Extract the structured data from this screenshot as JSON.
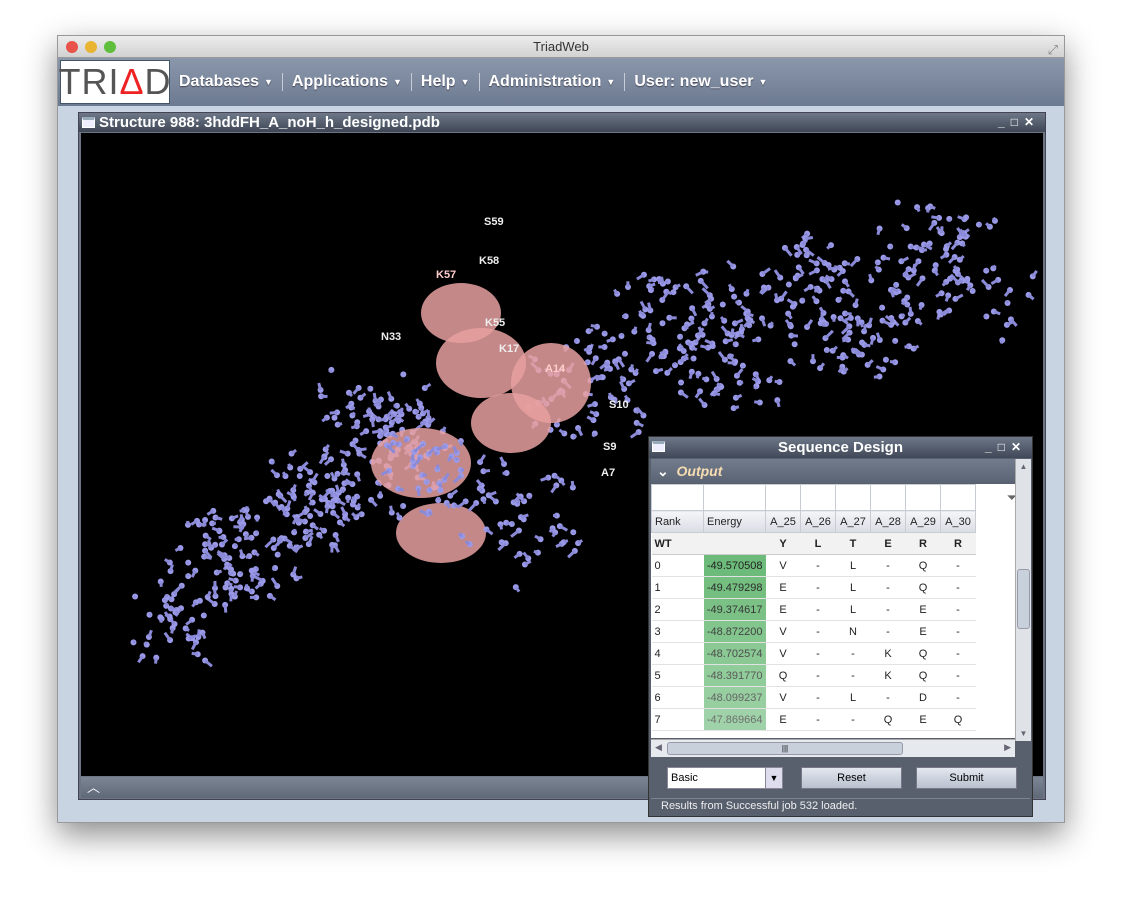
{
  "window": {
    "title": "TriadWeb"
  },
  "nav": {
    "logo": "TRIAD",
    "items": [
      {
        "label": "Databases"
      },
      {
        "label": "Applications"
      },
      {
        "label": "Help"
      },
      {
        "label": "Administration"
      },
      {
        "label": "User: new_user"
      }
    ]
  },
  "structure": {
    "title": "Structure 988: 3hddFH_A_noH_h_designed.pdb",
    "residue_labels": [
      "S59",
      "K58",
      "K57",
      "K55",
      "K17",
      "N33",
      "A14",
      "S10",
      "S9",
      "A7"
    ],
    "expand_icon": "chevron-up-icon"
  },
  "dialog": {
    "title": "Sequence Design",
    "section": "Output",
    "columns": [
      "Rank",
      "Energy",
      "A_25",
      "A_26",
      "A_27",
      "A_28",
      "A_29",
      "A_30"
    ],
    "wt": {
      "label": "WT",
      "residues": [
        "Y",
        "L",
        "T",
        "E",
        "R",
        "R"
      ]
    },
    "rows": [
      {
        "rank": "0",
        "energy": "-49.570508",
        "res": [
          "V",
          "-",
          "L",
          "-",
          "Q",
          "-"
        ]
      },
      {
        "rank": "1",
        "energy": "-49.479298",
        "res": [
          "E",
          "-",
          "L",
          "-",
          "Q",
          "-"
        ]
      },
      {
        "rank": "2",
        "energy": "-49.374617",
        "res": [
          "E",
          "-",
          "L",
          "-",
          "E",
          "-"
        ]
      },
      {
        "rank": "3",
        "energy": "-48.872200",
        "res": [
          "V",
          "-",
          "N",
          "-",
          "E",
          "-"
        ]
      },
      {
        "rank": "4",
        "energy": "-48.702574",
        "res": [
          "V",
          "-",
          "-",
          "K",
          "Q",
          "-"
        ]
      },
      {
        "rank": "5",
        "energy": "-48.391770",
        "res": [
          "Q",
          "-",
          "-",
          "K",
          "Q",
          "-"
        ]
      },
      {
        "rank": "6",
        "energy": "-48.099237",
        "res": [
          "V",
          "-",
          "L",
          "-",
          "D",
          "-"
        ]
      },
      {
        "rank": "7",
        "energy": "-47.869664",
        "res": [
          "E",
          "-",
          "-",
          "Q",
          "E",
          "Q"
        ]
      }
    ],
    "mode_select": "Basic",
    "reset": "Reset",
    "submit": "Submit",
    "status": "Results from Successful job 532 loaded.",
    "energy_color": "#6dbb7a"
  }
}
